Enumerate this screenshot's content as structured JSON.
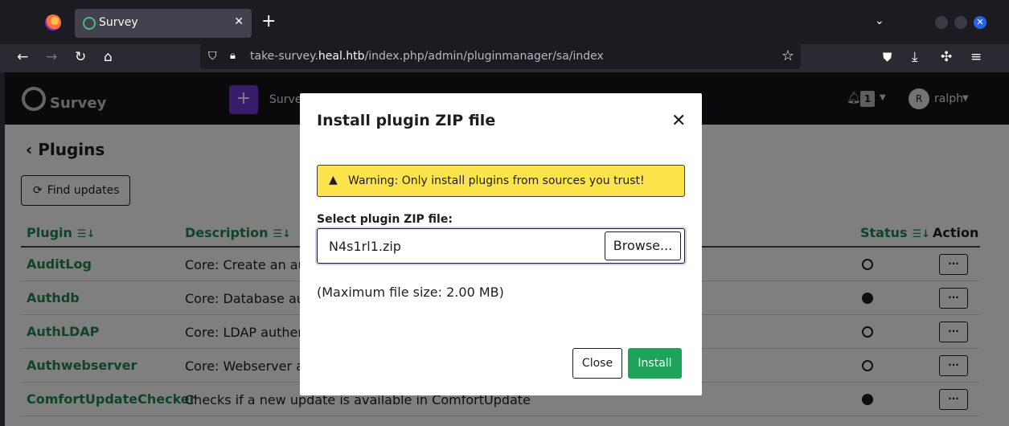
{
  "browser": {
    "tab_title": "Survey",
    "url_host_prefix": "take-survey.",
    "url_host": "heal.htb",
    "url_path": "/index.php/admin/pluginmanager/sa/index",
    "icons": [
      "firefox-icon",
      "back-icon",
      "forward-icon",
      "reload-icon",
      "home-icon",
      "shield-icon",
      "lock-icon",
      "bookmark-star-icon",
      "pocket-icon",
      "download-icon",
      "extensions-icon",
      "menu-icon"
    ]
  },
  "app": {
    "logo_text": "Survey",
    "create_label": "+",
    "surveys_label": "Surve",
    "notification_count": "1",
    "avatar_initial": "R",
    "username": "ralph"
  },
  "page": {
    "title": "Plugins",
    "find_updates_label": "Find updates",
    "columns": {
      "plugin": "Plugin",
      "description": "Description",
      "status": "Status",
      "action": "Action"
    },
    "rows": [
      {
        "name": "AuditLog",
        "description": "Core: Create an aud",
        "active": false
      },
      {
        "name": "Authdb",
        "description": "Core: Database auth",
        "active": true
      },
      {
        "name": "AuthLDAP",
        "description": "Core: LDAP authenti",
        "active": false
      },
      {
        "name": "Authwebserver",
        "description": "Core: Webserver aut",
        "active": false
      },
      {
        "name": "ComfortUpdateChecker",
        "description": "Checks if a new update is available in ComfortUpdate",
        "active": true
      }
    ],
    "action_label": "···"
  },
  "modal": {
    "title": "Install plugin ZIP file",
    "warning": "Warning: Only install plugins from sources you trust!",
    "file_label": "Select plugin ZIP file:",
    "file_value": "N4s1rl1.zip",
    "browse_label": "Browse...",
    "max_size": "(Maximum file size: 2.00 MB)",
    "close_label": "Close",
    "install_label": "Install"
  },
  "colors": {
    "accent_green": "#1fa35a",
    "warning_yellow": "#fde34c",
    "create_purple": "#6e3bd9"
  }
}
